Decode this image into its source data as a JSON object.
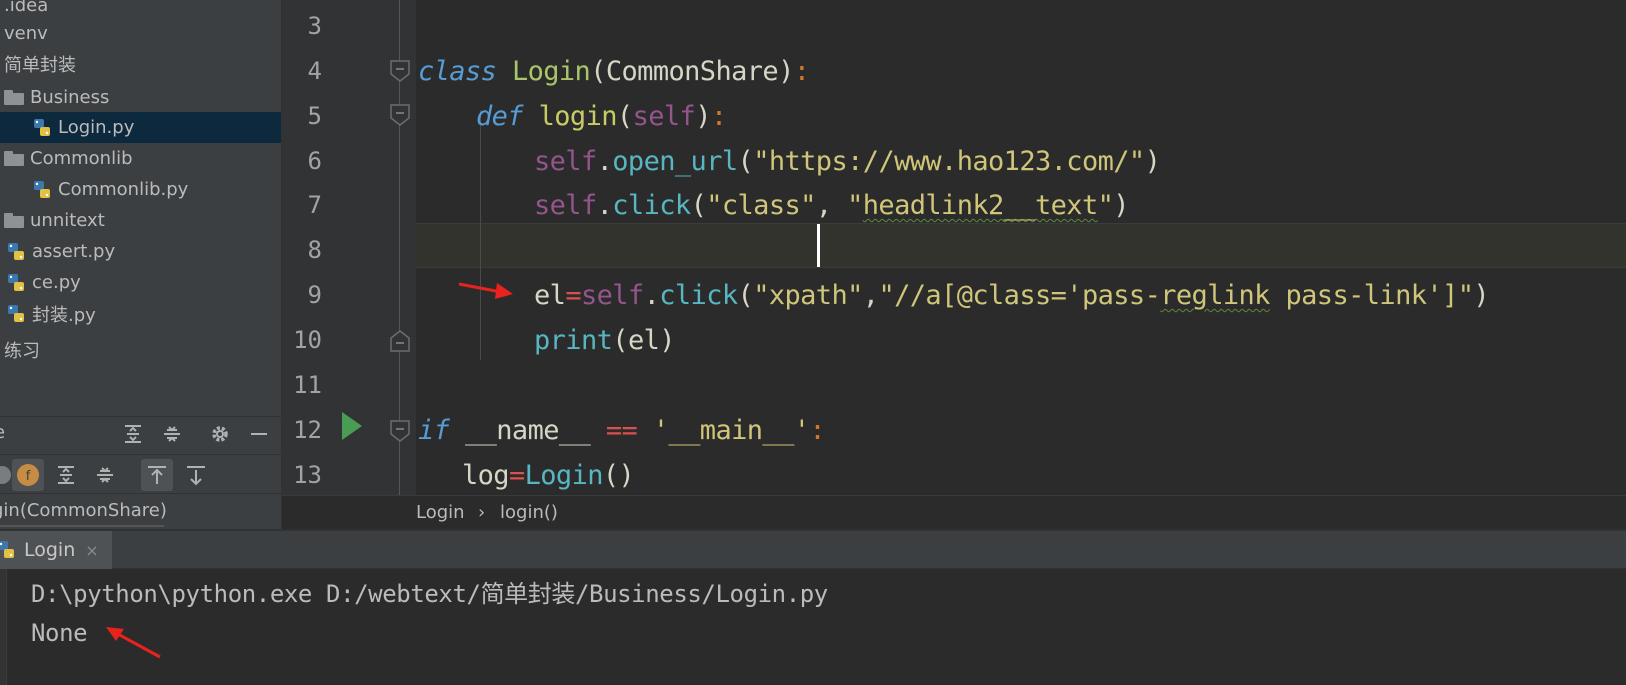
{
  "project_tree": {
    "items": [
      {
        "label": ".idea",
        "kind": "none"
      },
      {
        "label": "venv",
        "kind": "none"
      },
      {
        "label": "简单封装",
        "kind": "none"
      },
      {
        "label": "Business",
        "kind": "folder"
      },
      {
        "label": "Login.py",
        "kind": "python",
        "selected": true
      },
      {
        "label": "Commonlib",
        "kind": "folder"
      },
      {
        "label": "Commonlib.py",
        "kind": "python"
      },
      {
        "label": "unnitext",
        "kind": "folder"
      },
      {
        "label": "assert.py",
        "kind": "python"
      },
      {
        "label": "ce.py",
        "kind": "python"
      },
      {
        "label": "封装.py",
        "kind": "python"
      },
      {
        "label": "练习",
        "kind": "none"
      }
    ]
  },
  "structure": {
    "title": "e",
    "node": "gin(CommonShare)",
    "toolbar_icons": [
      "circle-icon",
      "field-icon",
      "expand-all-icon",
      "collapse-all-icon",
      "scroll-from-source-icon",
      "scroll-to-source-icon"
    ],
    "header_icons": [
      "expand-all-icon",
      "collapse-all-icon",
      "gear-icon",
      "minimize-icon"
    ]
  },
  "editor": {
    "line_numbers": [
      "3",
      "4",
      "5",
      "6",
      "7",
      "8",
      "9",
      "10",
      "11",
      "12",
      "13"
    ],
    "lines": {
      "l4": {
        "kw": "class",
        "name": "Login",
        "paren_open": "(",
        "base": "CommonShare",
        "paren_close": ")",
        "colon": ":"
      },
      "l5": {
        "kw": "def",
        "name": "login",
        "paren_open": "(",
        "self": "self",
        "paren_close": ")",
        "colon": ":"
      },
      "l6": {
        "self": "self",
        "dot": ".",
        "call": "open_url",
        "open": "(",
        "str": "\"https://www.hao123.com/\"",
        "close": ")"
      },
      "l7": {
        "self": "self",
        "dot": ".",
        "call": "click",
        "open": "(",
        "str1": "\"class\"",
        "comma": ", ",
        "str2a": "\"",
        "str2b": "headlink2__text",
        "str2c": "\"",
        "close": ")"
      },
      "l9": {
        "var": "el",
        "eq": "=",
        "self": "self",
        "dot": ".",
        "call": "click",
        "open": "(",
        "str1": "\"xpath\"",
        "comma": ",",
        "str2a": "\"//a[@class='pass-",
        "str2b": "reglink",
        "str2c": " pass-link']\"",
        "close": ")"
      },
      "l10": {
        "call": "print",
        "open": "(",
        "arg": "el",
        "close": ")"
      },
      "l12": {
        "kw": "if",
        "sp": " ",
        "dunder": "__name__",
        "sp2": " ",
        "eq": "==",
        "sp3": " ",
        "str": "'__main__'",
        "colon": ":"
      },
      "l13": {
        "var": "log",
        "eq": "=",
        "call": "Login",
        "parens": "()"
      }
    },
    "breadcrumb": [
      "Login",
      "login()"
    ],
    "breadcrumb_sep": "›"
  },
  "run": {
    "tab_label": "Login",
    "tab_close": "×",
    "console": [
      "D:\\python\\python.exe D:/webtext/简单封装/Business/Login.py",
      "None"
    ]
  },
  "colors": {
    "annotation_arrow": "#e8231e",
    "run_icon": "#499c54",
    "selection": "#0d293e"
  }
}
